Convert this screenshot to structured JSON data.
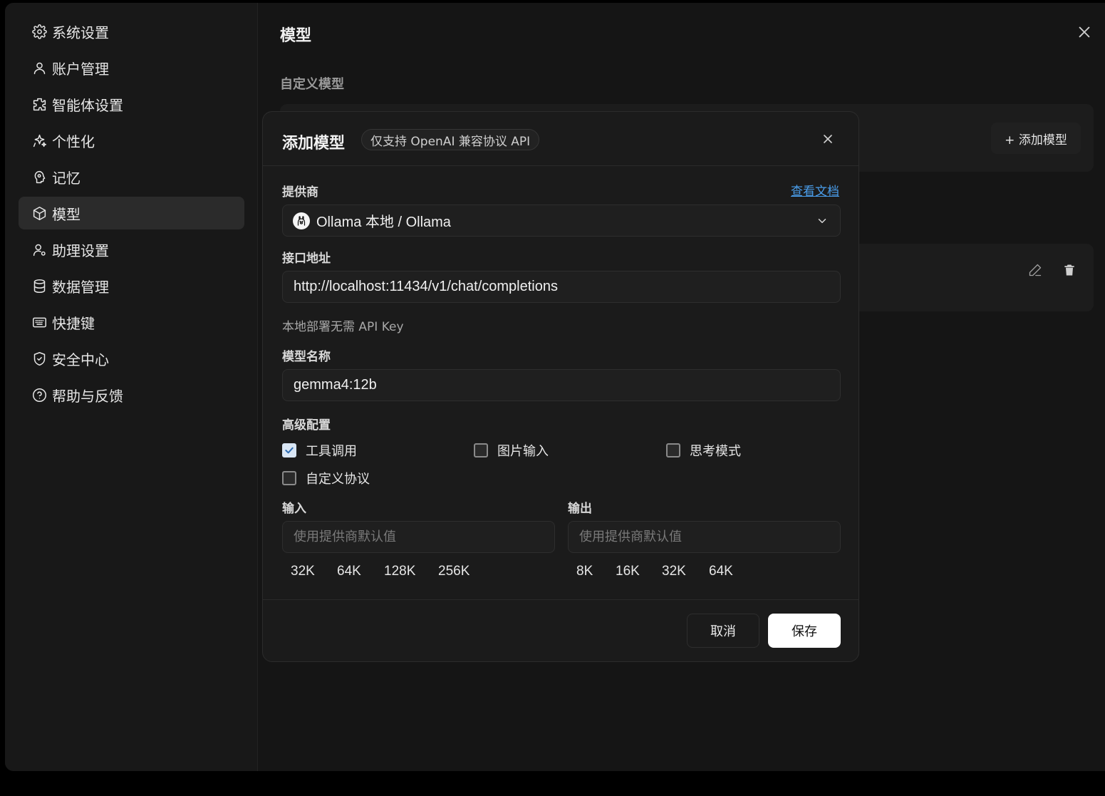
{
  "sidebar": {
    "items": [
      {
        "label": "系统设置",
        "icon": "gear-icon"
      },
      {
        "label": "账户管理",
        "icon": "user-icon"
      },
      {
        "label": "智能体设置",
        "icon": "puzzle-icon"
      },
      {
        "label": "个性化",
        "icon": "sparkle-icon"
      },
      {
        "label": "记忆",
        "icon": "memory-icon"
      },
      {
        "label": "模型",
        "icon": "cube-icon",
        "active": true
      },
      {
        "label": "助理设置",
        "icon": "user-gear-icon"
      },
      {
        "label": "数据管理",
        "icon": "database-icon"
      },
      {
        "label": "快捷键",
        "icon": "keyboard-icon"
      },
      {
        "label": "安全中心",
        "icon": "shield-icon"
      },
      {
        "label": "帮助与反馈",
        "icon": "help-icon"
      }
    ]
  },
  "main": {
    "title": "模型",
    "section_title": "自定义模型",
    "add_model_label": "+ 添加模型"
  },
  "modal": {
    "title": "添加模型",
    "badge": "仅支持 OpenAI 兼容协议 API",
    "provider_label": "提供商",
    "doc_link": "查看文档",
    "provider_value": "Ollama 本地 / Ollama",
    "endpoint_label": "接口地址",
    "endpoint_value": "http://localhost:11434/v1/chat/completions",
    "api_key_hint": "本地部署无需 API Key",
    "model_name_label": "模型名称",
    "model_name_value": "gemma4:12b",
    "advanced_label": "高级配置",
    "options": [
      {
        "label": "工具调用",
        "checked": true
      },
      {
        "label": "图片输入",
        "checked": false
      },
      {
        "label": "思考模式",
        "checked": false
      },
      {
        "label": "自定义协议",
        "checked": false
      }
    ],
    "input_label": "输入",
    "input_placeholder": "使用提供商默认值",
    "input_presets": [
      "32K",
      "64K",
      "128K",
      "256K"
    ],
    "output_label": "输出",
    "output_placeholder": "使用提供商默认值",
    "output_presets": [
      "8K",
      "16K",
      "32K",
      "64K"
    ],
    "cancel_label": "取消",
    "save_label": "保存"
  },
  "colors": {
    "accent_link": "#4a9dea",
    "background": "#151515",
    "modal": "#1b1b1b"
  }
}
